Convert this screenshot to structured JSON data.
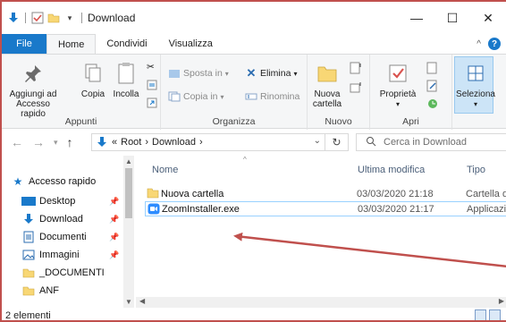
{
  "window": {
    "title": "Download",
    "controls": [
      "—",
      "☐",
      "✕"
    ]
  },
  "ribbon_tabs": [
    "File",
    "Home",
    "Condividi",
    "Visualizza"
  ],
  "ribbon": {
    "appunti": {
      "label": "Appunti",
      "pin_label_1": "Aggiungi ad",
      "pin_label_2": "Accesso rapido",
      "copy_label": "Copia",
      "paste_label": "Incolla"
    },
    "organizza": {
      "label": "Organizza",
      "move_label": "Sposta in",
      "copy_to_label": "Copia in",
      "delete_label": "Elimina",
      "rename_label": "Rinomina"
    },
    "nuovo": {
      "label": "Nuovo",
      "new_folder_1": "Nuova",
      "new_folder_2": "cartella"
    },
    "apri": {
      "label": "Apri",
      "properties_label": "Proprietà"
    },
    "seleziona": {
      "label": "Seleziona"
    }
  },
  "address": {
    "prefix": "«",
    "crumbs": [
      "Root",
      "Download"
    ],
    "search_placeholder": "Cerca in Download"
  },
  "nav_pane": {
    "items": [
      {
        "label": "Accesso rapido",
        "icon": "star-icon"
      },
      {
        "label": "Desktop",
        "icon": "desktop-icon",
        "pinned": true
      },
      {
        "label": "Download",
        "icon": "download-icon",
        "pinned": true
      },
      {
        "label": "Documenti",
        "icon": "documents-icon",
        "pinned": true
      },
      {
        "label": "Immagini",
        "icon": "pictures-icon",
        "pinned": true
      },
      {
        "label": "_DOCUMENTI",
        "icon": "folder-icon"
      },
      {
        "label": "ANF",
        "icon": "folder-icon"
      }
    ]
  },
  "file_list": {
    "columns": [
      "Nome",
      "Ultima modifica",
      "Tipo"
    ],
    "rows": [
      {
        "name": "Nuova cartella",
        "modified": "03/03/2020 21:18",
        "type": "Cartella d",
        "icon": "folder-icon"
      },
      {
        "name": "ZoomInstaller.exe",
        "modified": "03/03/2020 21:17",
        "type": "Applicazi",
        "icon": "zoom-app-icon"
      }
    ]
  },
  "status": {
    "item_count": "2 elementi"
  },
  "colors": {
    "accent": "#1979ca",
    "frame_border": "#c0504d",
    "arrow": "#c0504d",
    "folder": "#f8d775"
  }
}
